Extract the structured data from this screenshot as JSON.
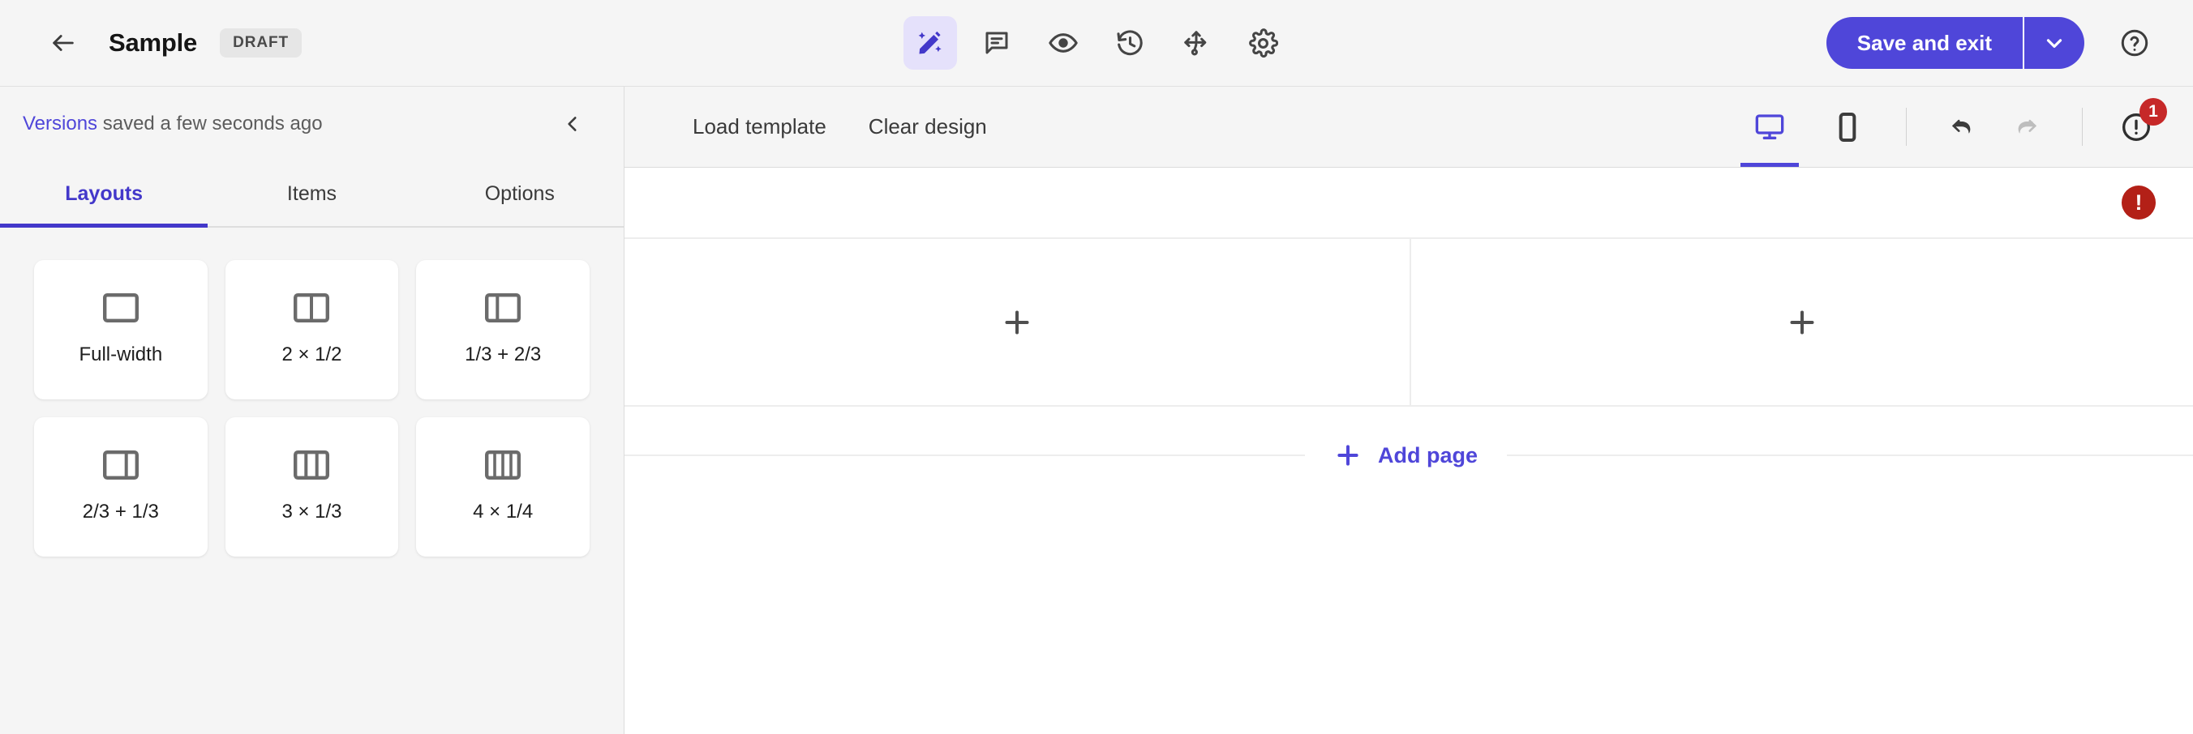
{
  "header": {
    "back_icon": "arrow-left-icon",
    "title": "Sample",
    "status_badge": "DRAFT",
    "tools": [
      {
        "name": "design-tool",
        "icon": "magic-wand-pencil-icon",
        "active": true
      },
      {
        "name": "comments-tool",
        "icon": "comment-icon",
        "active": false
      },
      {
        "name": "preview-tool",
        "icon": "eye-icon",
        "active": false
      },
      {
        "name": "history-tool",
        "icon": "history-clock-icon",
        "active": false
      },
      {
        "name": "flow-tool",
        "icon": "branch-arrows-icon",
        "active": false
      },
      {
        "name": "settings-tool",
        "icon": "gear-icon",
        "active": false
      }
    ],
    "save_label": "Save and exit",
    "save_caret_icon": "chevron-down-icon",
    "help_icon": "question-circle-icon",
    "accent_color": "#4f46d9"
  },
  "sidebar": {
    "versions_link": "Versions",
    "versions_status": "saved a few seconds ago",
    "collapse_icon": "chevron-left-icon",
    "tabs": [
      {
        "label": "Layouts",
        "active": true
      },
      {
        "label": "Items",
        "active": false
      },
      {
        "label": "Options",
        "active": false
      }
    ],
    "layouts": [
      {
        "label": "Full-width",
        "columns": [
          1
        ]
      },
      {
        "label": "2 × 1/2",
        "columns": [
          1,
          1
        ]
      },
      {
        "label": "1/3 + 2/3",
        "columns": [
          1,
          2
        ]
      },
      {
        "label": "2/3 + 1/3",
        "columns": [
          2,
          1
        ]
      },
      {
        "label": "3 × 1/3",
        "columns": [
          1,
          1,
          1
        ]
      },
      {
        "label": "4 × 1/4",
        "columns": [
          1,
          1,
          1,
          1
        ]
      }
    ]
  },
  "canvas_toolbar": {
    "load_template": "Load template",
    "clear_design": "Clear design",
    "devices": [
      {
        "name": "desktop",
        "icon": "desktop-monitor-icon",
        "active": true
      },
      {
        "name": "mobile",
        "icon": "mobile-phone-icon",
        "active": false
      }
    ],
    "undo_icon": "undo-arrow-icon",
    "redo_icon": "redo-arrow-icon",
    "undo_enabled": true,
    "redo_enabled": false,
    "alert_icon": "exclamation-circle-icon",
    "alert_count": "1"
  },
  "canvas": {
    "page_error_icon": "exclamation-circle-filled-icon",
    "page_error_glyph": "!",
    "error_color": "#b32017",
    "cells": [
      {
        "name": "canvas-cell-left",
        "add_icon": "plus-icon"
      },
      {
        "name": "canvas-cell-right",
        "add_icon": "plus-icon"
      }
    ],
    "add_page_label": "Add page",
    "add_page_icon": "plus-icon"
  }
}
